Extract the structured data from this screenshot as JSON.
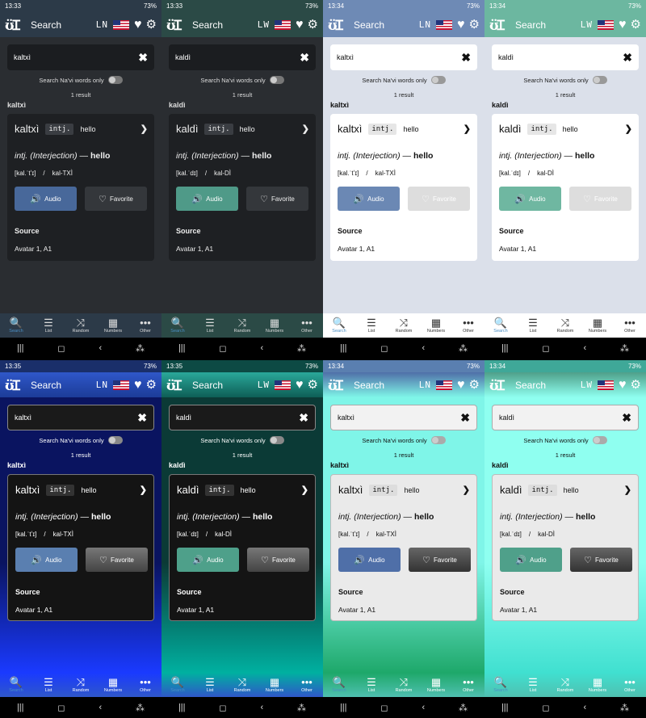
{
  "panels": [
    {
      "time": "13:33",
      "word": "kaltxì",
      "lang": "LN",
      "ipa1": "[kal.ˈtʼɪ]",
      "ipa2": "kal-TXÌ",
      "theme": "dark",
      "accent": "#48689a",
      "appbar": "#2c3a48"
    },
    {
      "time": "13:33",
      "word": "kaldì",
      "lang": "LW",
      "ipa1": "[kal.ˈdɪ]",
      "ipa2": "kal-DÌ",
      "theme": "dark",
      "accent": "#4f9a88",
      "appbar": "#2c3a48"
    },
    {
      "time": "13:34",
      "word": "kaltxì",
      "lang": "LN",
      "ipa1": "[kal.ˈtʼɪ]",
      "ipa2": "kal-TXÌ",
      "theme": "light",
      "accent": "#6b88b4",
      "appbar": "#6e8ab5",
      "bg": "#dbe0ea"
    },
    {
      "time": "13:34",
      "word": "kaldì",
      "lang": "LW",
      "ipa1": "[kal.ˈdɪ]",
      "ipa2": "kal-DÌ",
      "theme": "light",
      "accent": "#6fb7a1",
      "appbar": "#6cb7a0",
      "bg": "#dbe0ea"
    },
    {
      "time": "13:35",
      "word": "kaltxì",
      "lang": "LN",
      "ipa1": "[kal.ˈtʼɪ]",
      "ipa2": "kal-TXÌ",
      "theme": "grad-dark",
      "accent": "#5a7fb0",
      "bgTop": "#0a1460",
      "bgBottom": "#1a3aff"
    },
    {
      "time": "13:35",
      "word": "kaldì",
      "lang": "LW",
      "ipa1": "[kal.ˈdɪ]",
      "ipa2": "kal-DÌ",
      "theme": "grad-dark",
      "accent": "#4ea08a",
      "bgTop": "#0b3a36",
      "bgBottom": "#00b0a0"
    },
    {
      "time": "13:34",
      "word": "kaltxì",
      "lang": "LN",
      "ipa1": "[kal.ˈtʼɪ]",
      "ipa2": "kal-TXÌ",
      "theme": "grad-light",
      "accent": "#4f6fa8",
      "bgTop": "#7ff5e8",
      "bgBottom": "#1ea86a"
    },
    {
      "time": "13:34",
      "word": "kaldì",
      "lang": "LW",
      "ipa1": "[kal.ˈdɪ]",
      "ipa2": "kal-DÌ",
      "theme": "grad-light",
      "accent": "#4fa08a",
      "bgTop": "#8ffff0",
      "bgBottom": "#40e0d0"
    }
  ],
  "common": {
    "battery": "73%",
    "search_title": "Search",
    "logo": "ʊ̈Ɪ",
    "navi_only": "Search Na'vi words only",
    "result_count": "1 result",
    "pos": "intj.",
    "translation": "hello",
    "def_pos": "intj. (Interjection)",
    "def_dash": " — ",
    "def_word": "hello",
    "ipa_sep": "/",
    "audio": "Audio",
    "favorite": "Favorite",
    "source_label": "Source",
    "source_value": "Avatar 1, A1",
    "tabs": [
      "Search",
      "List",
      "Random",
      "Numbers",
      "Other"
    ],
    "tab_icons": [
      "🔍",
      "☰",
      "⤨",
      "▦",
      "•••"
    ],
    "sys_nav": [
      "|||",
      "◻",
      "‹",
      "⁂"
    ]
  }
}
